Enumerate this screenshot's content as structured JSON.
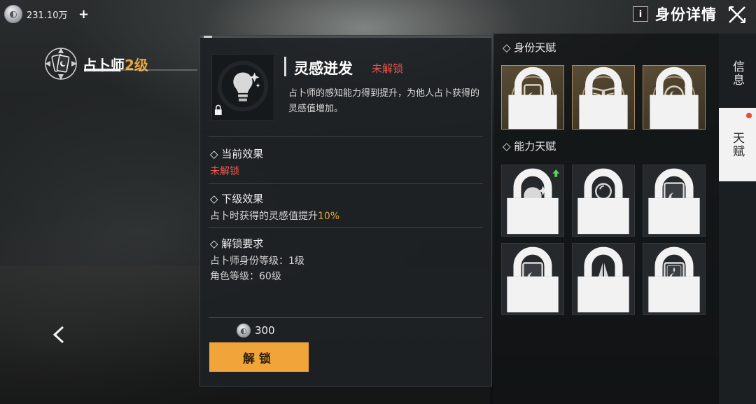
{
  "header": {
    "currency_amount": "231.10万",
    "add_label": "+",
    "info_label": "i",
    "title": "身份详情"
  },
  "identity": {
    "name": "占卜师",
    "level": "2级"
  },
  "detail": {
    "skill_name": "灵感迸发",
    "skill_status": "未解锁",
    "description": "占卜师的感知能力得到提升，为他人占卜获得的灵感值增加。",
    "current_effect_title": "◇ 当前效果",
    "current_effect_value": "未解锁",
    "next_effect_title": "◇ 下级效果",
    "next_effect_text": "占卜时获得的灵感值提升",
    "next_effect_value": "10%",
    "requirements_title": "◇ 解锁要求",
    "requirement_1": "占卜师身份等级：1级",
    "requirement_2": "角色等级：60级",
    "cost": "300",
    "unlock_label": "解锁"
  },
  "talents": {
    "identity_section": "◇ 身份天赋",
    "ability_section": "◇ 能力天赋",
    "identity_tiles": [
      {
        "icon": "moon-card-icon"
      },
      {
        "icon": "open-book-icon"
      },
      {
        "icon": "crystal-ball-moon-icon"
      }
    ],
    "ability_tiles": [
      {
        "icon": "lightbulb-icon",
        "upgradable": true
      },
      {
        "icon": "crystal-ball-table-icon"
      },
      {
        "icon": "moon-card-icon"
      },
      {
        "icon": "moon-card-icon"
      },
      {
        "icon": "praying-hands-icon"
      },
      {
        "icon": "ornate-moon-card-icon"
      }
    ]
  },
  "tabs": {
    "info": "信息",
    "talent": "天赋"
  },
  "colors": {
    "accent": "#f0a43a",
    "locked_red": "#e65a4f",
    "level_gold": "#e8a43a"
  }
}
